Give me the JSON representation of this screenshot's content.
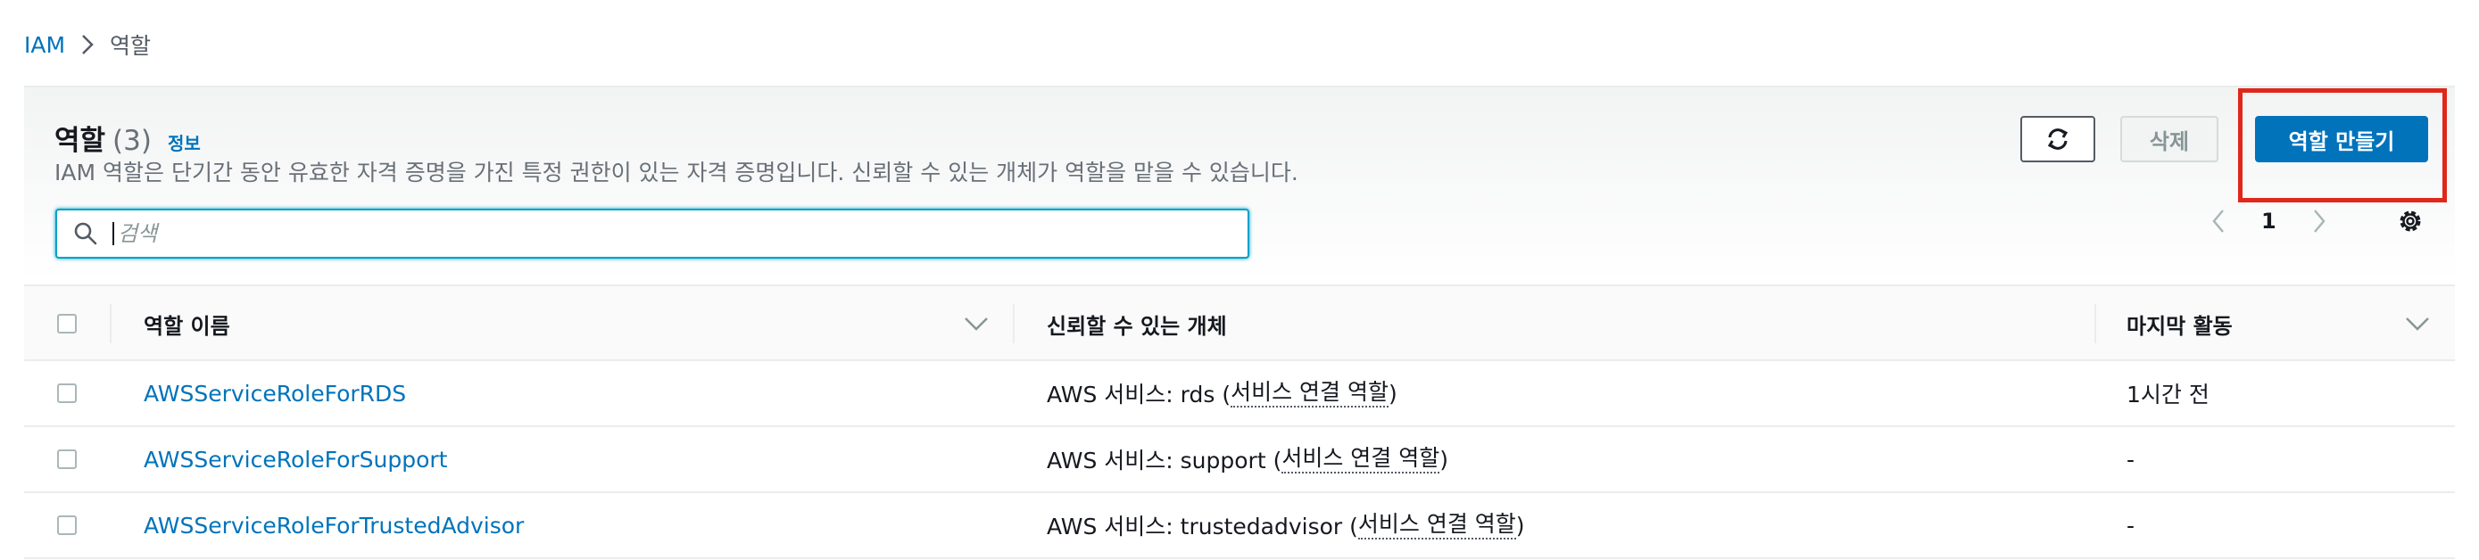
{
  "breadcrumb": {
    "root": "IAM",
    "current": "역할"
  },
  "panel": {
    "title": "역할",
    "count": "(3)",
    "info_link": "정보",
    "description": "IAM 역할은 단기간 동안 유효한 자격 증명을 가진 특정 권한이 있는 자격 증명입니다. 신뢰할 수 있는 개체가 역할을 맡을 수 있습니다.",
    "delete_label": "삭제",
    "create_label": "역할 만들기"
  },
  "search": {
    "placeholder": "검색",
    "value": ""
  },
  "pagination": {
    "current_page": "1"
  },
  "table": {
    "columns": [
      "역할 이름",
      "신뢰할 수 있는 개체",
      "마지막 활동"
    ],
    "rows": [
      {
        "name": "AWSServiceRoleForRDS",
        "entity_prefix": "AWS 서비스: rds (",
        "entity_link": "서비스 연결 역할",
        "entity_suffix": ")",
        "last_activity": "1시간 전"
      },
      {
        "name": "AWSServiceRoleForSupport",
        "entity_prefix": "AWS 서비스: support (",
        "entity_link": "서비스 연결 역할",
        "entity_suffix": ")",
        "last_activity": "-"
      },
      {
        "name": "AWSServiceRoleForTrustedAdvisor",
        "entity_prefix": "AWS 서비스: trustedadvisor (",
        "entity_link": "서비스 연결 역할",
        "entity_suffix": ")",
        "last_activity": "-"
      }
    ]
  },
  "icons": {
    "breadcrumb_separator": "chevron-right-icon",
    "refresh": "refresh-icon",
    "search": "search-icon",
    "settings": "gear-icon",
    "sort": "caret-down-icon"
  },
  "colors": {
    "link": "#0073bb",
    "primary_button": "#0073bb",
    "highlight_box": "#e0271b",
    "search_focus": "#00a1c9"
  }
}
